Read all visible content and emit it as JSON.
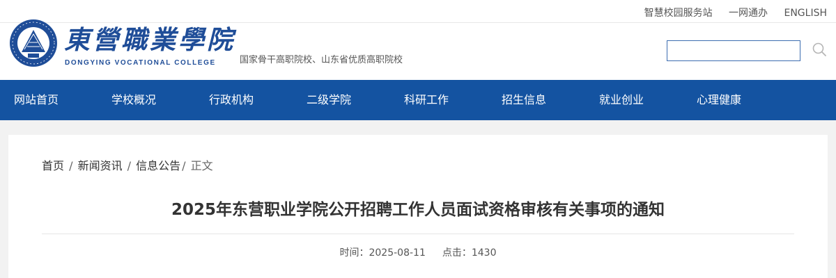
{
  "top_links": [
    "智慧校园服务站",
    "一网通办",
    "ENGLISH"
  ],
  "brand": {
    "cn_name": "東營職業學院",
    "en_name": "DONGYING VOCATIONAL COLLEGE",
    "tagline": "国家骨干高职院校、山东省优质高职院校",
    "primary_color": "#1f4d98"
  },
  "search": {
    "value": "",
    "placeholder": "",
    "icon": "search-icon"
  },
  "nav": {
    "background": "#1453a1",
    "items": [
      "网站首页",
      "学校概况",
      "行政机构",
      "二级学院",
      "科研工作",
      "招生信息",
      "就业创业",
      "心理健康"
    ]
  },
  "breadcrumb": {
    "home": "首页",
    "section": "新闻资讯",
    "category": "信息公告",
    "current": "正文"
  },
  "article": {
    "title": "2025年东营职业学院公开招聘工作人员面试资格审核有关事项的通知",
    "time_label": "时间：",
    "date": "2025-08-11",
    "clicks_label": "点击：",
    "clicks": "1430"
  }
}
